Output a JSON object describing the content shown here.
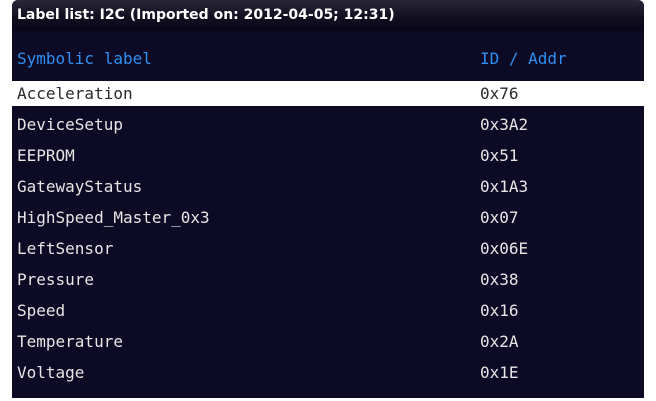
{
  "window": {
    "title": "Label list: I2C (Imported on: 2012-04-05; 12:31)"
  },
  "table": {
    "columns": {
      "label": "Symbolic label",
      "id": "ID / Addr"
    },
    "selected_index": 0,
    "rows": [
      {
        "label": "Acceleration",
        "id": "0x76"
      },
      {
        "label": "DeviceSetup",
        "id": "0x3A2"
      },
      {
        "label": "EEPROM",
        "id": "0x51"
      },
      {
        "label": "GatewayStatus",
        "id": "0x1A3"
      },
      {
        "label": "HighSpeed_Master_0x3",
        "id": "0x07"
      },
      {
        "label": "LeftSensor",
        "id": "0x06E"
      },
      {
        "label": "Pressure",
        "id": "0x38"
      },
      {
        "label": "Speed",
        "id": "0x16"
      },
      {
        "label": "Temperature",
        "id": "0x2A"
      },
      {
        "label": "Voltage",
        "id": "0x1E"
      }
    ]
  },
  "colors": {
    "background": "#0c0a24",
    "header_text": "#2f8ff2",
    "row_text": "#e6e6e6",
    "selection_background": "#ffffff",
    "selection_text": "#2a2a2a"
  }
}
